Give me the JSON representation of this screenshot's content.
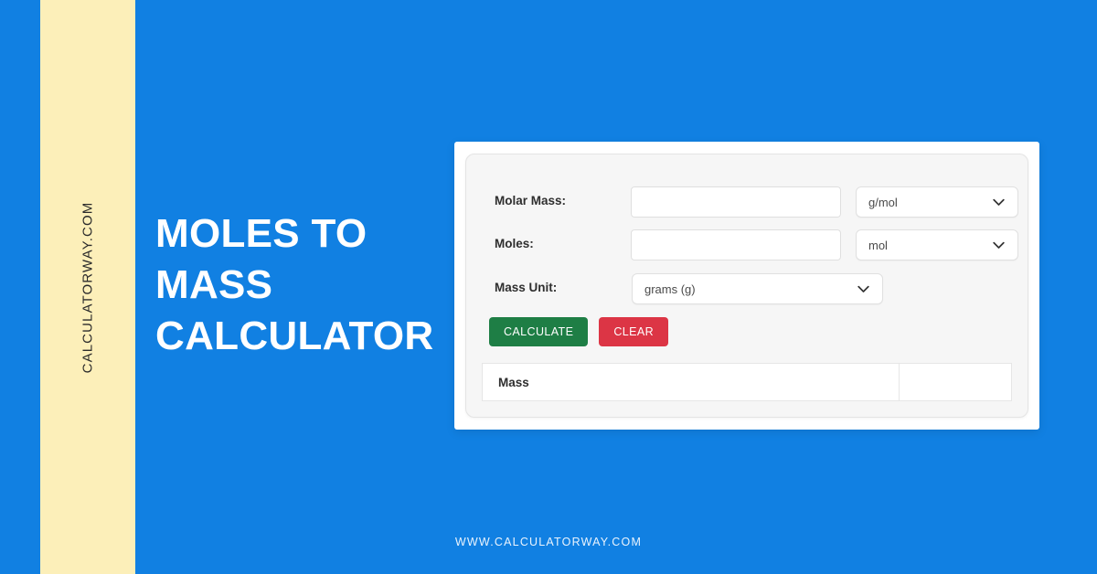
{
  "page": {
    "background_color": "#1180e2",
    "accent_band_color": "#fcefb9"
  },
  "branding": {
    "vertical_text": "CALCULATORWAY.COM",
    "footer_url": "WWW.CALCULATORWAY.COM"
  },
  "headline": {
    "line1": "MOLES TO",
    "line2": "MASS",
    "line3": "CALCULATOR"
  },
  "calculator": {
    "fields": [
      {
        "label": "Molar Mass:",
        "input_value": "",
        "input_placeholder": "",
        "unit_value": "g/mol"
      },
      {
        "label": "Moles:",
        "input_value": "",
        "input_placeholder": "",
        "unit_value": "mol"
      },
      {
        "label": "Mass Unit:",
        "unit_value": "grams (g)"
      }
    ],
    "buttons": {
      "calculate_label": "Calculate",
      "calculate_color": "#1e7e45",
      "clear_label": "Clear",
      "clear_color": "#dc3545"
    },
    "result": {
      "label": "Mass",
      "value": ""
    },
    "icons": {
      "dropdown": "chevron-down-icon"
    }
  }
}
